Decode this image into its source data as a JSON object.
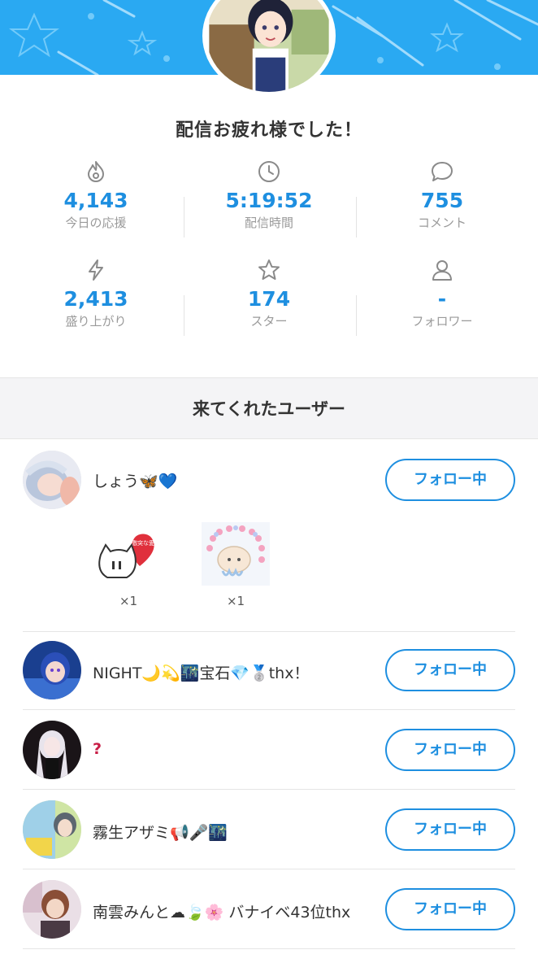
{
  "headline": "配信お疲れ様でした！",
  "stats": [
    {
      "icon": "fire-icon",
      "value": "4,143",
      "label": "今日の応援"
    },
    {
      "icon": "clock-icon",
      "value": "5:19:52",
      "label": "配信時間"
    },
    {
      "icon": "comment-icon",
      "value": "755",
      "label": "コメント"
    },
    {
      "icon": "lightning-icon",
      "value": "2,413",
      "label": "盛り上がり"
    },
    {
      "icon": "star-icon",
      "value": "174",
      "label": "スター"
    },
    {
      "icon": "person-icon",
      "value": "-",
      "label": "フォロワー"
    }
  ],
  "section_title": "来てくれたユーザー",
  "follow_label": "フォロー中",
  "users": [
    {
      "name": "しょう🦋💙"
    },
    {
      "name": "NIGHT🌙💫🌃宝石💎🥈thx！"
    },
    {
      "name": "?"
    },
    {
      "name": "霧生アザミ📢🎤🌃"
    },
    {
      "name": "南雲みんと☁🍃🌸 バナイベ43位thx"
    }
  ],
  "gift_text": "激突な愛",
  "gifts": [
    {
      "icon": "cat-love-gift-icon",
      "count": "×1"
    },
    {
      "icon": "jellyfish-gift-icon",
      "count": "×1"
    }
  ],
  "colors": {
    "banner": "#2aa9f2",
    "accent": "#1e8fe0"
  }
}
